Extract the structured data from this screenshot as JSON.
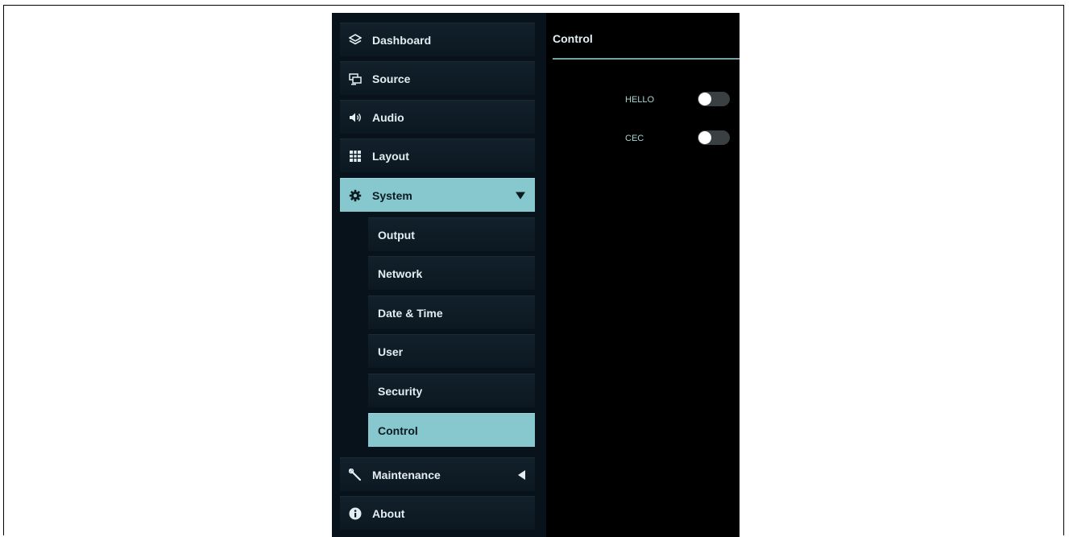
{
  "sidebar": {
    "items": [
      {
        "label": "Dashboard",
        "icon": "layers-icon"
      },
      {
        "label": "Source",
        "icon": "monitor-icon"
      },
      {
        "label": "Audio",
        "icon": "speaker-icon"
      },
      {
        "label": "Layout",
        "icon": "grid-icon"
      },
      {
        "label": "System",
        "icon": "gear-icon",
        "expanded": true
      },
      {
        "label": "Maintenance",
        "icon": "wrench-icon",
        "expanded": false
      },
      {
        "label": "About",
        "icon": "info-icon"
      }
    ],
    "system_subitems": [
      {
        "label": "Output"
      },
      {
        "label": "Network"
      },
      {
        "label": "Date & Time"
      },
      {
        "label": "User"
      },
      {
        "label": "Security"
      },
      {
        "label": "Control",
        "active": true
      }
    ]
  },
  "content": {
    "title": "Control",
    "settings": [
      {
        "label": "HELLO",
        "enabled": false
      },
      {
        "label": "CEC",
        "enabled": false
      }
    ]
  },
  "colors": {
    "accent": "#86c8cd",
    "background": "#000000",
    "sidebar_item": "#12202b"
  }
}
